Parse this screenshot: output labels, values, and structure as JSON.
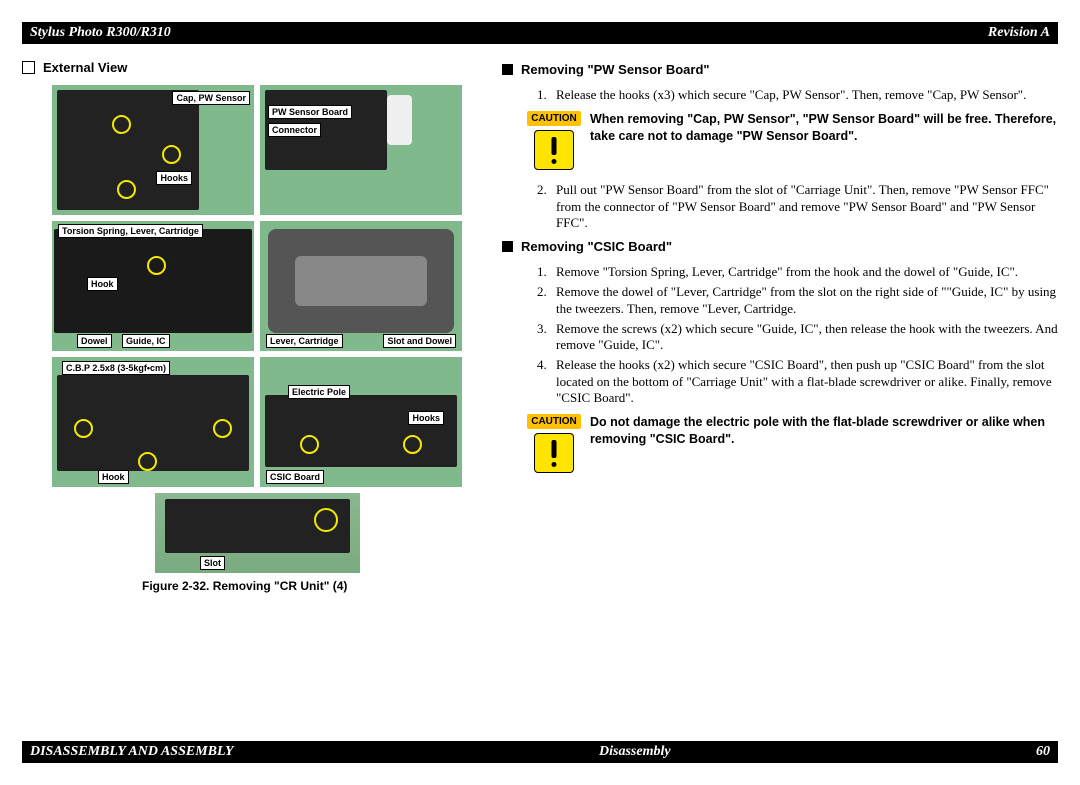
{
  "header": {
    "left": "Stylus Photo R300/R310",
    "right": "Revision A"
  },
  "footer": {
    "left": "DISASSEMBLY AND ASSEMBLY",
    "center": "Disassembly",
    "right": "60"
  },
  "left": {
    "title": "External View",
    "labels": {
      "p1_cap": "Cap, PW Sensor",
      "p1_hooks": "Hooks",
      "p2_board": "PW Sensor Board",
      "p2_conn": "Connector",
      "p3_torsion": "Torsion Spring, Lever, Cartridge",
      "p3_hook": "Hook",
      "p3_dowel": "Dowel",
      "p3_guide": "Guide, IC",
      "p4_lever": "Lever, Cartridge",
      "p4_slot": "Slot and Dowel",
      "p5_cbp": "C.B.P 2.5x8 (3-5kgf•cm)",
      "p5_hook": "Hook",
      "p6_ep": "Electric Pole",
      "p6_hooks": "Hooks",
      "p6_csic": "CSIC Board",
      "p7_slot": "Slot"
    },
    "figure_caption": "Figure 2-32.  Removing \"CR Unit\" (4)"
  },
  "right": {
    "removing_pw": {
      "title": "Removing \"PW Sensor Board\"",
      "step1": "Release the hooks (x3) which secure \"Cap, PW Sensor\". Then, remove \"Cap, PW Sensor\".",
      "caution1": "When removing \"Cap, PW Sensor\", \"PW Sensor Board\" will be free. Therefore, take care not to damage \"PW Sensor Board\".",
      "step2": "Pull out \"PW Sensor Board\" from the slot of \"Carriage Unit\". Then, remove \"PW Sensor FFC\" from the connector of \"PW Sensor Board\" and remove \"PW Sensor Board\" and \"PW Sensor FFC\"."
    },
    "removing_csic": {
      "title": "Removing \"CSIC Board\"",
      "step1": "Remove \"Torsion Spring, Lever, Cartridge\" from the hook and the dowel of \"Guide, IC\".",
      "step2": "Remove the dowel of \"Lever, Cartridge\" from the slot on the right side of \"\"Guide, IC\" by using the tweezers. Then, remove \"Lever, Cartridge.",
      "step3": "Remove the screws (x2) which secure \"Guide, IC\", then release the hook with the tweezers. And remove \"Guide, IC\".",
      "step4": "Release the hooks (x2) which secure \"CSIC Board\", then push up \"CSIC Board\" from the slot located on the bottom of \"Carriage Unit\" with a flat-blade screwdriver or alike. Finally, remove \"CSIC Board\".",
      "caution2": "Do not damage the electric pole with the flat-blade screwdriver or alike when removing \"CSIC Board\"."
    },
    "caution_label": "CAUTION"
  }
}
